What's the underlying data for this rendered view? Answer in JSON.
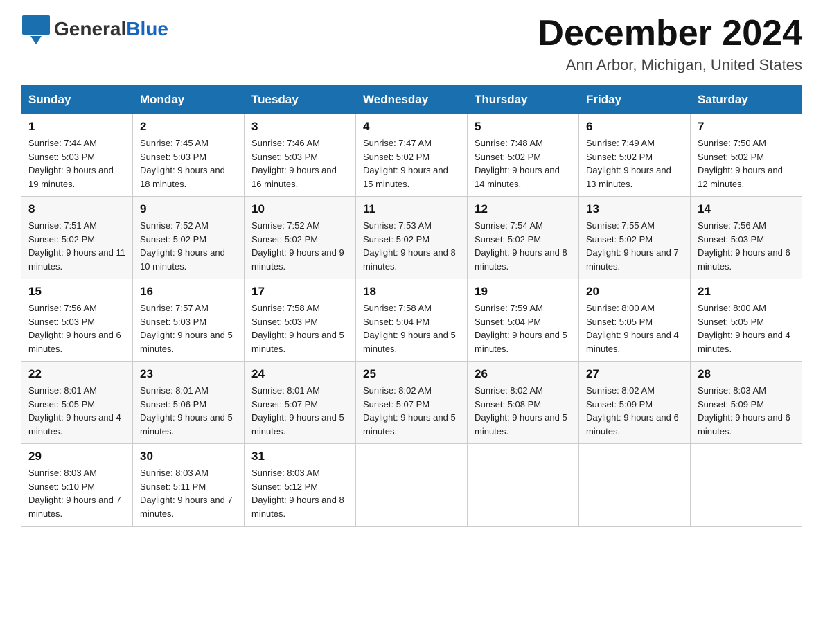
{
  "header": {
    "logo_general": "General",
    "logo_blue": "Blue",
    "month_year": "December 2024",
    "location": "Ann Arbor, Michigan, United States"
  },
  "days_of_week": [
    "Sunday",
    "Monday",
    "Tuesday",
    "Wednesday",
    "Thursday",
    "Friday",
    "Saturday"
  ],
  "weeks": [
    [
      {
        "day": "1",
        "sunrise": "7:44 AM",
        "sunset": "5:03 PM",
        "daylight": "9 hours and 19 minutes."
      },
      {
        "day": "2",
        "sunrise": "7:45 AM",
        "sunset": "5:03 PM",
        "daylight": "9 hours and 18 minutes."
      },
      {
        "day": "3",
        "sunrise": "7:46 AM",
        "sunset": "5:03 PM",
        "daylight": "9 hours and 16 minutes."
      },
      {
        "day": "4",
        "sunrise": "7:47 AM",
        "sunset": "5:02 PM",
        "daylight": "9 hours and 15 minutes."
      },
      {
        "day": "5",
        "sunrise": "7:48 AM",
        "sunset": "5:02 PM",
        "daylight": "9 hours and 14 minutes."
      },
      {
        "day": "6",
        "sunrise": "7:49 AM",
        "sunset": "5:02 PM",
        "daylight": "9 hours and 13 minutes."
      },
      {
        "day": "7",
        "sunrise": "7:50 AM",
        "sunset": "5:02 PM",
        "daylight": "9 hours and 12 minutes."
      }
    ],
    [
      {
        "day": "8",
        "sunrise": "7:51 AM",
        "sunset": "5:02 PM",
        "daylight": "9 hours and 11 minutes."
      },
      {
        "day": "9",
        "sunrise": "7:52 AM",
        "sunset": "5:02 PM",
        "daylight": "9 hours and 10 minutes."
      },
      {
        "day": "10",
        "sunrise": "7:52 AM",
        "sunset": "5:02 PM",
        "daylight": "9 hours and 9 minutes."
      },
      {
        "day": "11",
        "sunrise": "7:53 AM",
        "sunset": "5:02 PM",
        "daylight": "9 hours and 8 minutes."
      },
      {
        "day": "12",
        "sunrise": "7:54 AM",
        "sunset": "5:02 PM",
        "daylight": "9 hours and 8 minutes."
      },
      {
        "day": "13",
        "sunrise": "7:55 AM",
        "sunset": "5:02 PM",
        "daylight": "9 hours and 7 minutes."
      },
      {
        "day": "14",
        "sunrise": "7:56 AM",
        "sunset": "5:03 PM",
        "daylight": "9 hours and 6 minutes."
      }
    ],
    [
      {
        "day": "15",
        "sunrise": "7:56 AM",
        "sunset": "5:03 PM",
        "daylight": "9 hours and 6 minutes."
      },
      {
        "day": "16",
        "sunrise": "7:57 AM",
        "sunset": "5:03 PM",
        "daylight": "9 hours and 5 minutes."
      },
      {
        "day": "17",
        "sunrise": "7:58 AM",
        "sunset": "5:03 PM",
        "daylight": "9 hours and 5 minutes."
      },
      {
        "day": "18",
        "sunrise": "7:58 AM",
        "sunset": "5:04 PM",
        "daylight": "9 hours and 5 minutes."
      },
      {
        "day": "19",
        "sunrise": "7:59 AM",
        "sunset": "5:04 PM",
        "daylight": "9 hours and 5 minutes."
      },
      {
        "day": "20",
        "sunrise": "8:00 AM",
        "sunset": "5:05 PM",
        "daylight": "9 hours and 4 minutes."
      },
      {
        "day": "21",
        "sunrise": "8:00 AM",
        "sunset": "5:05 PM",
        "daylight": "9 hours and 4 minutes."
      }
    ],
    [
      {
        "day": "22",
        "sunrise": "8:01 AM",
        "sunset": "5:05 PM",
        "daylight": "9 hours and 4 minutes."
      },
      {
        "day": "23",
        "sunrise": "8:01 AM",
        "sunset": "5:06 PM",
        "daylight": "9 hours and 5 minutes."
      },
      {
        "day": "24",
        "sunrise": "8:01 AM",
        "sunset": "5:07 PM",
        "daylight": "9 hours and 5 minutes."
      },
      {
        "day": "25",
        "sunrise": "8:02 AM",
        "sunset": "5:07 PM",
        "daylight": "9 hours and 5 minutes."
      },
      {
        "day": "26",
        "sunrise": "8:02 AM",
        "sunset": "5:08 PM",
        "daylight": "9 hours and 5 minutes."
      },
      {
        "day": "27",
        "sunrise": "8:02 AM",
        "sunset": "5:09 PM",
        "daylight": "9 hours and 6 minutes."
      },
      {
        "day": "28",
        "sunrise": "8:03 AM",
        "sunset": "5:09 PM",
        "daylight": "9 hours and 6 minutes."
      }
    ],
    [
      {
        "day": "29",
        "sunrise": "8:03 AM",
        "sunset": "5:10 PM",
        "daylight": "9 hours and 7 minutes."
      },
      {
        "day": "30",
        "sunrise": "8:03 AM",
        "sunset": "5:11 PM",
        "daylight": "9 hours and 7 minutes."
      },
      {
        "day": "31",
        "sunrise": "8:03 AM",
        "sunset": "5:12 PM",
        "daylight": "9 hours and 8 minutes."
      },
      null,
      null,
      null,
      null
    ]
  ]
}
